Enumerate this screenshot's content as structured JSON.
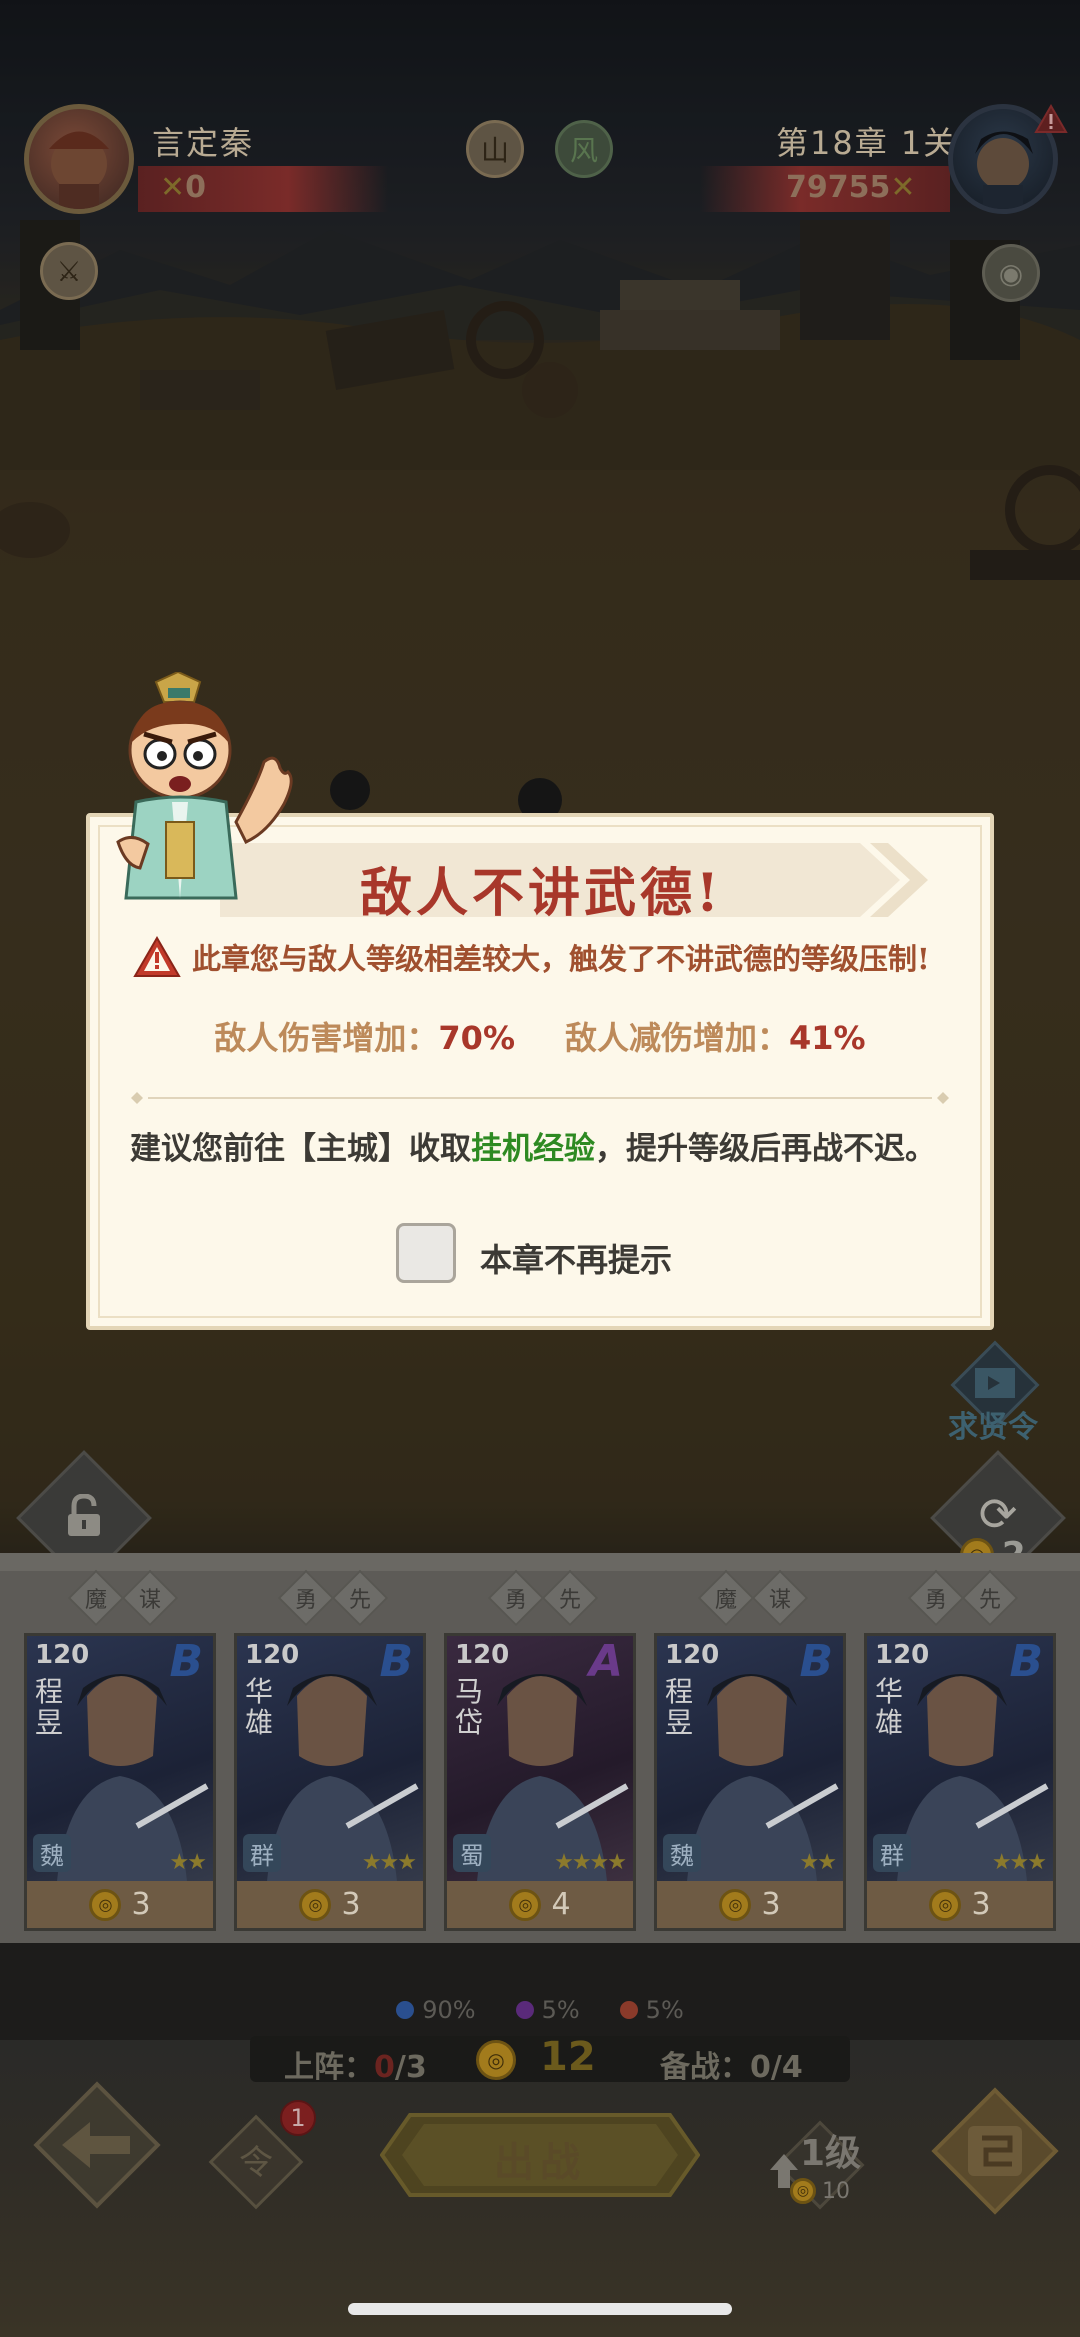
{
  "player": {
    "name": "言定秦",
    "power": "0"
  },
  "enemy": {
    "stage": "第18章 1关",
    "power": "79755"
  },
  "top_icons": [
    "山",
    "风"
  ],
  "modal": {
    "title": "敌人不讲武德!",
    "warning": "此章您与敌人等级相差较大，触发了不讲武德的等级压制!",
    "stats": [
      {
        "label": "敌人伤害增加：",
        "value": "70%"
      },
      {
        "label": "敌人减伤增加：",
        "value": "41%"
      }
    ],
    "advice_pre": "建议您前往【主城】收取",
    "advice_highlight": "挂机经验",
    "advice_post": "，提升等级后再战不迟。",
    "checkbox_label": "本章不再提示",
    "checkbox_checked": false
  },
  "side": {
    "recruit_label": "求贤令",
    "refresh_cost": "2"
  },
  "cards": [
    {
      "level": "120",
      "name": "程昱",
      "grade": "B",
      "faction": "魏",
      "stars": 2,
      "cost": "3",
      "tags": [
        "魔",
        "谋"
      ]
    },
    {
      "level": "120",
      "name": "华雄",
      "grade": "B",
      "faction": "群",
      "stars": 3,
      "cost": "3",
      "tags": [
        "勇",
        "先"
      ]
    },
    {
      "level": "120",
      "name": "马岱",
      "grade": "A",
      "faction": "蜀",
      "stars": 4,
      "cost": "4",
      "tags": [
        "勇",
        "先"
      ]
    },
    {
      "level": "120",
      "name": "程昱",
      "grade": "B",
      "faction": "魏",
      "stars": 2,
      "cost": "3",
      "tags": [
        "魔",
        "谋"
      ]
    },
    {
      "level": "120",
      "name": "华雄",
      "grade": "B",
      "faction": "群",
      "stars": 3,
      "cost": "3",
      "tags": [
        "勇",
        "先"
      ]
    }
  ],
  "odds": [
    {
      "value": "90%",
      "color": "#2a4f8f"
    },
    {
      "value": "5%",
      "color": "#5a2a7a"
    },
    {
      "value": "5%",
      "color": "#8a3a2a"
    }
  ],
  "deploy": {
    "on_label": "上阵：",
    "on_current": "0",
    "on_max": "/3",
    "coins": "12",
    "reserve": "备战：0/4"
  },
  "bottom": {
    "fight_label": "出战",
    "upgrade_label": "1级",
    "upgrade_cost": "10",
    "badge_count": "1",
    "ling_label": "令"
  },
  "colors": {
    "modal_bg": "#fdf8ea",
    "title_red": "#a8372a",
    "highlight_green": "#2e8a22"
  }
}
